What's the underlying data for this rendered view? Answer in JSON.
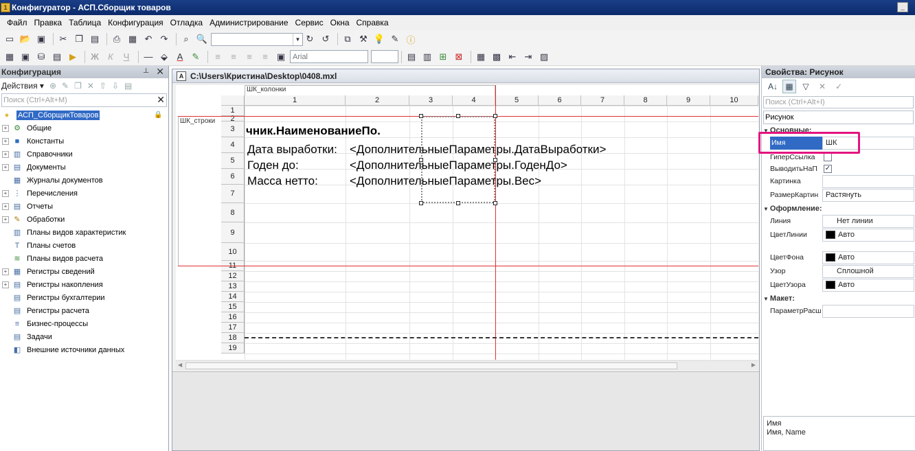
{
  "window": {
    "title": "Конфигуратор - АСП.Сборщик товаров"
  },
  "menu": [
    "Файл",
    "Правка",
    "Таблица",
    "Конфигурация",
    "Отладка",
    "Администрирование",
    "Сервис",
    "Окна",
    "Справка"
  ],
  "toolbar2": {
    "font_name": "Arial"
  },
  "left_panel": {
    "title": "Конфигурация",
    "actions_label": "Действия",
    "search_placeholder": "Поиск (Ctrl+Alt+M)",
    "root": "АСП_СборщикТоваров",
    "items": [
      {
        "label": "Общие",
        "icon": "general-icon",
        "glyph": "⚙",
        "color": "#3a8a3a",
        "expandable": true
      },
      {
        "label": "Константы",
        "icon": "constants-icon",
        "glyph": "■",
        "color": "#2d6fbf",
        "expandable": true
      },
      {
        "label": "Справочники",
        "icon": "catalogs-icon",
        "glyph": "▥",
        "color": "#4a6fa5",
        "expandable": true
      },
      {
        "label": "Документы",
        "icon": "documents-icon",
        "glyph": "▤",
        "color": "#4a6fa5",
        "expandable": true
      },
      {
        "label": "Журналы документов",
        "icon": "journals-icon",
        "glyph": "▦",
        "color": "#4a6fa5",
        "expandable": false
      },
      {
        "label": "Перечисления",
        "icon": "enums-icon",
        "glyph": "⋮",
        "color": "#4a6fa5",
        "expandable": true
      },
      {
        "label": "Отчеты",
        "icon": "reports-icon",
        "glyph": "▤",
        "color": "#4a6fa5",
        "expandable": true
      },
      {
        "label": "Обработки",
        "icon": "processing-icon",
        "glyph": "✎",
        "color": "#b07a10",
        "expandable": true
      },
      {
        "label": "Планы видов характеристик",
        "icon": "chart-of-characteristics-icon",
        "glyph": "▥",
        "color": "#4a6fa5",
        "expandable": false
      },
      {
        "label": "Планы счетов",
        "icon": "chart-of-accounts-icon",
        "glyph": "T",
        "color": "#4a6fa5",
        "expandable": false
      },
      {
        "label": "Планы видов расчета",
        "icon": "calculation-types-icon",
        "glyph": "≋",
        "color": "#3a8a3a",
        "expandable": false
      },
      {
        "label": "Регистры сведений",
        "icon": "info-registers-icon",
        "glyph": "▦",
        "color": "#4a6fa5",
        "expandable": true
      },
      {
        "label": "Регистры накопления",
        "icon": "accumulation-registers-icon",
        "glyph": "▤",
        "color": "#4a6fa5",
        "expandable": true
      },
      {
        "label": "Регистры бухгалтерии",
        "icon": "accounting-registers-icon",
        "glyph": "▤",
        "color": "#4a6fa5",
        "expandable": false
      },
      {
        "label": "Регистры расчета",
        "icon": "calculation-registers-icon",
        "glyph": "▤",
        "color": "#4a6fa5",
        "expandable": false
      },
      {
        "label": "Бизнес-процессы",
        "icon": "business-processes-icon",
        "glyph": "≡",
        "color": "#4a6fa5",
        "expandable": false
      },
      {
        "label": "Задачи",
        "icon": "tasks-icon",
        "glyph": "▤",
        "color": "#4a6fa5",
        "expandable": false
      },
      {
        "label": "Внешние источники данных",
        "icon": "external-sources-icon",
        "glyph": "◧",
        "color": "#4a6fa5",
        "expandable": false
      }
    ]
  },
  "document": {
    "title": "C:\\Users\\Кристина\\Desktop\\0408.mxl",
    "columns_area_label": "ШК_колонки",
    "rows_area_label": "ШК_строки",
    "columns": [
      "1",
      "2",
      "3",
      "4",
      "5",
      "6",
      "7",
      "8",
      "9",
      "10"
    ],
    "rows": [
      "1",
      "2",
      "3",
      "4",
      "5",
      "6",
      "7",
      "8",
      "9",
      "10",
      "11",
      "12",
      "13",
      "14",
      "15",
      "16",
      "17",
      "18",
      "19"
    ],
    "cells": {
      "r3": "чник.НаименованиеПо.",
      "r4_label": "Дата выработки:",
      "r4_value": "<ДополнительныеПараметры.ДатаВыработки>",
      "r5_label": "Годен до:",
      "r5_value": "<ДополнительныеПараметры.ГоденДо>",
      "r6_label": "Масса нетто:",
      "r6_value": "<ДополнительныеПараметры.Вес>"
    }
  },
  "properties": {
    "title": "Свойства: Рисунок",
    "search_placeholder": "Поиск (Ctrl+Alt+I)",
    "object_type": "Рисунок",
    "sections": {
      "main": "Основные:",
      "design": "Оформление:",
      "layout": "Макет:"
    },
    "rows": {
      "name_label": "Имя",
      "name_value": "ШК",
      "hyperlink_label": "ГиперСсылка",
      "print_label": "ВыводитьНаП",
      "picture_label": "Картинка",
      "picture_value": "",
      "picture_size_label": "РазмерКартин",
      "picture_size_value": "Растянуть",
      "line_label": "Линия",
      "line_value": "Нет линии",
      "line_color_label": "ЦветЛинии",
      "line_color_value": "Авто",
      "bg_color_label": "ЦветФона",
      "bg_color_value": "Авто",
      "pattern_label": "Узор",
      "pattern_value": "Сплошной",
      "pattern_color_label": "ЦветУзора",
      "pattern_color_value": "Авто",
      "param_label": "ПараметрРасш",
      "param_value": ""
    },
    "description_line1": "Имя",
    "description_line2": "Имя, Name"
  }
}
